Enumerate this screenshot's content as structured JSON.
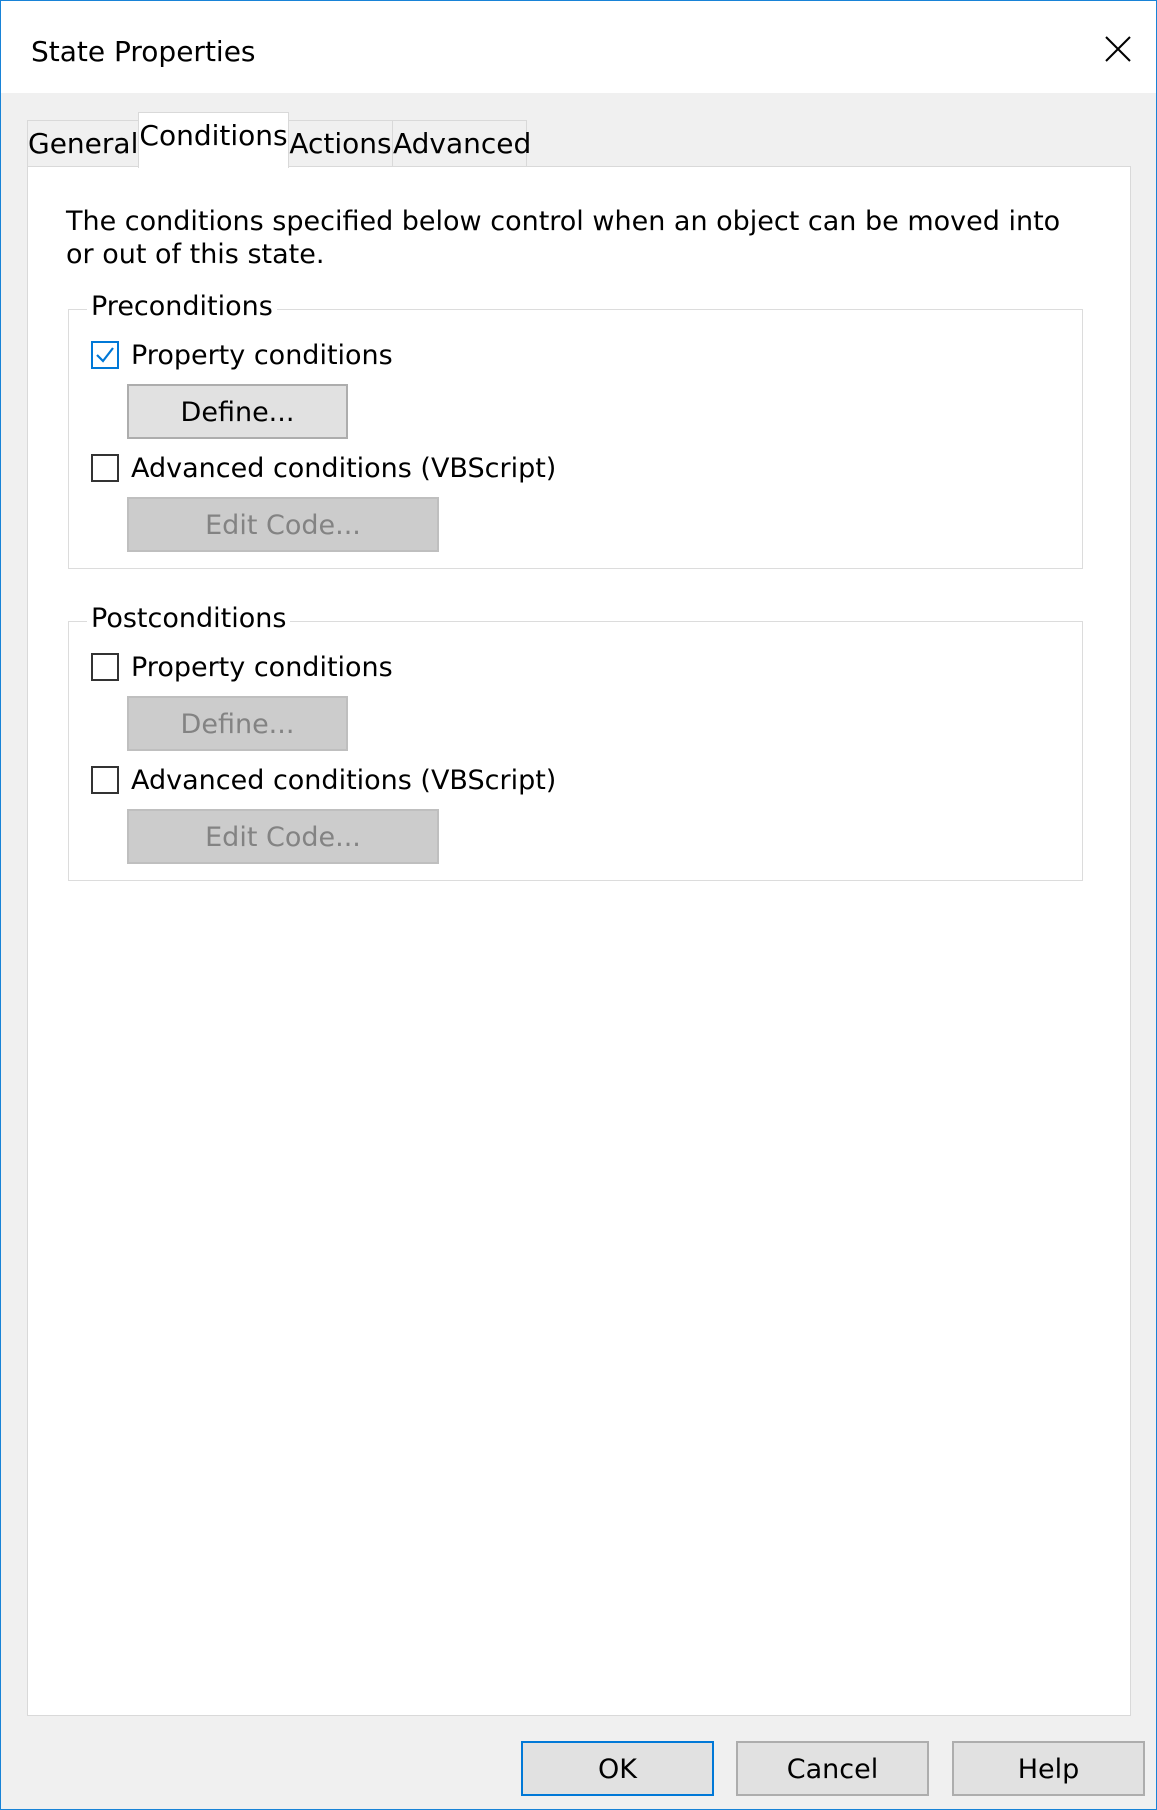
{
  "window": {
    "title": "State Properties"
  },
  "tabs": [
    {
      "label": "General",
      "active": false
    },
    {
      "label": "Conditions",
      "active": true
    },
    {
      "label": "Actions",
      "active": false
    },
    {
      "label": "Advanced",
      "active": false
    }
  ],
  "description": "The conditions specified below control when an object can be moved into or out of this state.",
  "preconditions": {
    "title": "Preconditions",
    "property_conditions": {
      "label": "Property conditions",
      "checked": true
    },
    "define_button": {
      "label": "Define...",
      "enabled": true
    },
    "advanced_conditions": {
      "label": "Advanced conditions (VBScript)",
      "checked": false
    },
    "edit_code_button": {
      "label": "Edit Code...",
      "enabled": false
    }
  },
  "postconditions": {
    "title": "Postconditions",
    "property_conditions": {
      "label": "Property conditions",
      "checked": false
    },
    "define_button": {
      "label": "Define...",
      "enabled": false
    },
    "advanced_conditions": {
      "label": "Advanced conditions (VBScript)",
      "checked": false
    },
    "edit_code_button": {
      "label": "Edit Code...",
      "enabled": false
    }
  },
  "footer": {
    "ok": "OK",
    "cancel": "Cancel",
    "help": "Help"
  },
  "colors": {
    "accent": "#0078d7",
    "window_border": "#1883d7",
    "disabled_text": "#838383"
  }
}
